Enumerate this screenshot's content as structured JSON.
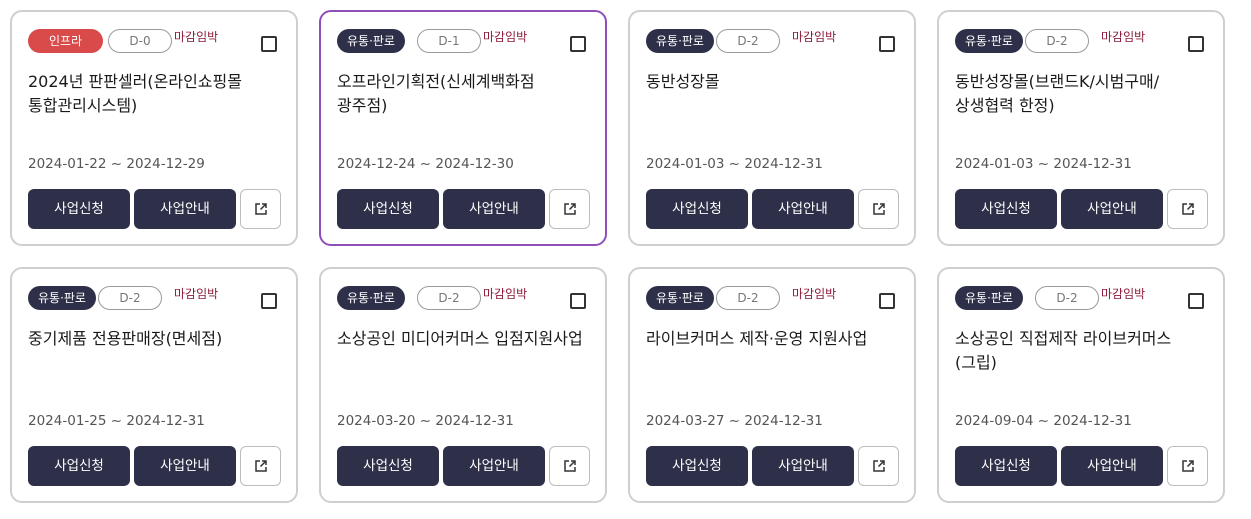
{
  "labels": {
    "deadline_badge": "마감임박",
    "apply_button": "사업신청",
    "guide_button": "사업안내"
  },
  "colors": {
    "category_dark": "#2e3049",
    "category_infra": "#d94a4a",
    "deadline_text": "#8c1c3a",
    "selected_border": "#8f4fb8"
  },
  "cards": [
    {
      "category": "인프라",
      "dday": "D-0",
      "title": "2024년 판판셀러(온라인쇼핑몰 통합관리시스템)",
      "period": "2024-01-22 ~ 2024-12-29"
    },
    {
      "category": "유통·판로",
      "dday": "D-1",
      "title": "오프라인기획전(신세계백화점 광주점)",
      "period": "2024-12-24 ~ 2024-12-30"
    },
    {
      "category": "유통·판로",
      "dday": "D-2",
      "title": "동반성장몰",
      "period": "2024-01-03 ~ 2024-12-31"
    },
    {
      "category": "유통·판로",
      "dday": "D-2",
      "title": "동반성장몰(브랜드K/시범구매/상생협력 한정)",
      "period": "2024-01-03 ~ 2024-12-31"
    },
    {
      "category": "유통·판로",
      "dday": "D-2",
      "title": "중기제품 전용판매장(면세점)",
      "period": "2024-01-25 ~ 2024-12-31"
    },
    {
      "category": "유통·판로",
      "dday": "D-2",
      "title": "소상공인 미디어커머스 입점지원사업",
      "period": "2024-03-20 ~ 2024-12-31"
    },
    {
      "category": "유통·판로",
      "dday": "D-2",
      "title": "라이브커머스 제작·운영 지원사업",
      "period": "2024-03-27 ~ 2024-12-31"
    },
    {
      "category": "유통·판로",
      "dday": "D-2",
      "title": "소상공인 직접제작 라이브커머스(그립)",
      "period": "2024-09-04 ~ 2024-12-31"
    }
  ]
}
